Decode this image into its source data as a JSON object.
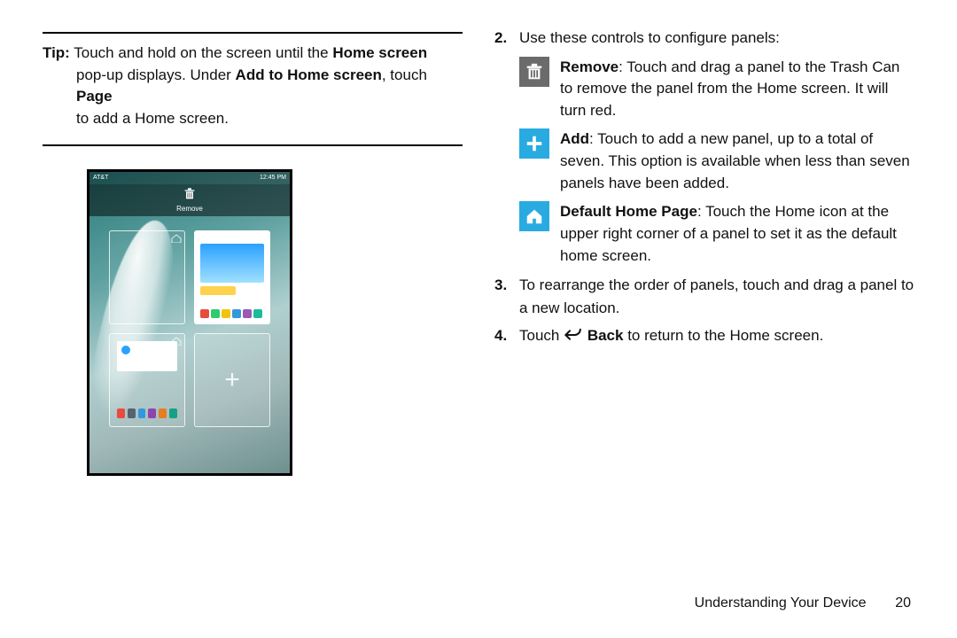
{
  "tip": {
    "label": "Tip:",
    "line1_a": " Touch and hold on the screen until the ",
    "line1_b": "Home screen",
    "line2_a": "pop-up displays. Under ",
    "line2_b": "Add to Home screen",
    "line2_c": ", touch ",
    "line2_d": "Page",
    "line3": "to add a Home screen."
  },
  "phone": {
    "carrier": "AT&T",
    "time": "12:45 PM",
    "remove_label": "Remove"
  },
  "right": {
    "item2_num": "2.",
    "item2_text": "Use these controls to configure panels:",
    "remove_b": "Remove",
    "remove_t": ": Touch and drag a panel to the Trash Can to remove the panel from the Home screen. It will turn red.",
    "add_b": "Add",
    "add_t": ": Touch to add a new panel, up to a total of seven. This option is available when less than seven panels have been added.",
    "home_b": "Default Home Page",
    "home_t": ": Touch the Home icon at the upper right corner of a panel to set it as the default home screen.",
    "item3_num": "3.",
    "item3_text": "To rearrange the order of panels, touch and drag a panel to a new location.",
    "item4_num": "4.",
    "item4_a": "Touch ",
    "item4_b": " Back",
    "item4_c": " to return to the Home screen."
  },
  "footer": {
    "section": "Understanding Your Device",
    "page": "20"
  },
  "colors": {
    "dock": [
      "#e74c3c",
      "#2ecc71",
      "#f1c40f",
      "#3498db",
      "#9b59b6",
      "#1abc9c"
    ],
    "dock2": [
      "#e74c3c",
      "#556270",
      "#3498db",
      "#8e44ad",
      "#e67e22",
      "#16a085"
    ]
  }
}
